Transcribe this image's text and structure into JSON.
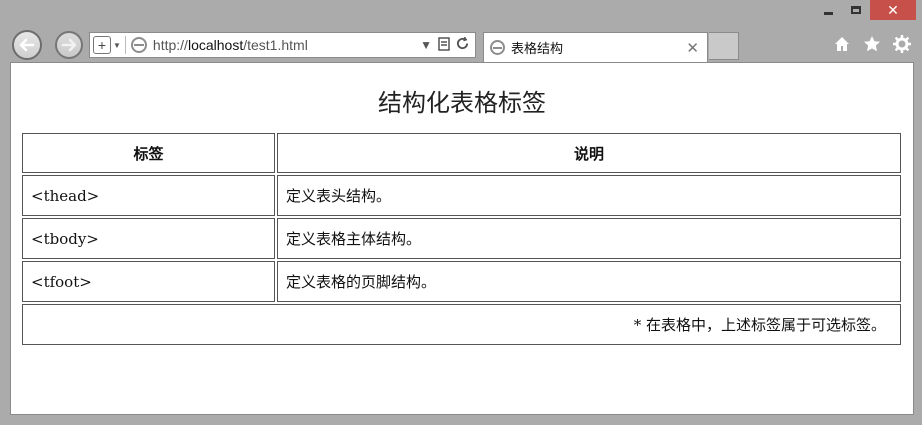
{
  "browser": {
    "url_prefix": "http://",
    "url_host": "localhost",
    "url_path": "/test1.html",
    "tab_title": "表格结构"
  },
  "page": {
    "title": "结构化表格标签",
    "table": {
      "headers": [
        "标签",
        "说明"
      ],
      "rows": [
        [
          "<thead>",
          "定义表头结构。"
        ],
        [
          "<tbody>",
          "定义表格主体结构。"
        ],
        [
          "<tfoot>",
          "定义表格的页脚结构。"
        ]
      ],
      "footer": "* 在表格中，上述标签属于可选标签。"
    }
  }
}
